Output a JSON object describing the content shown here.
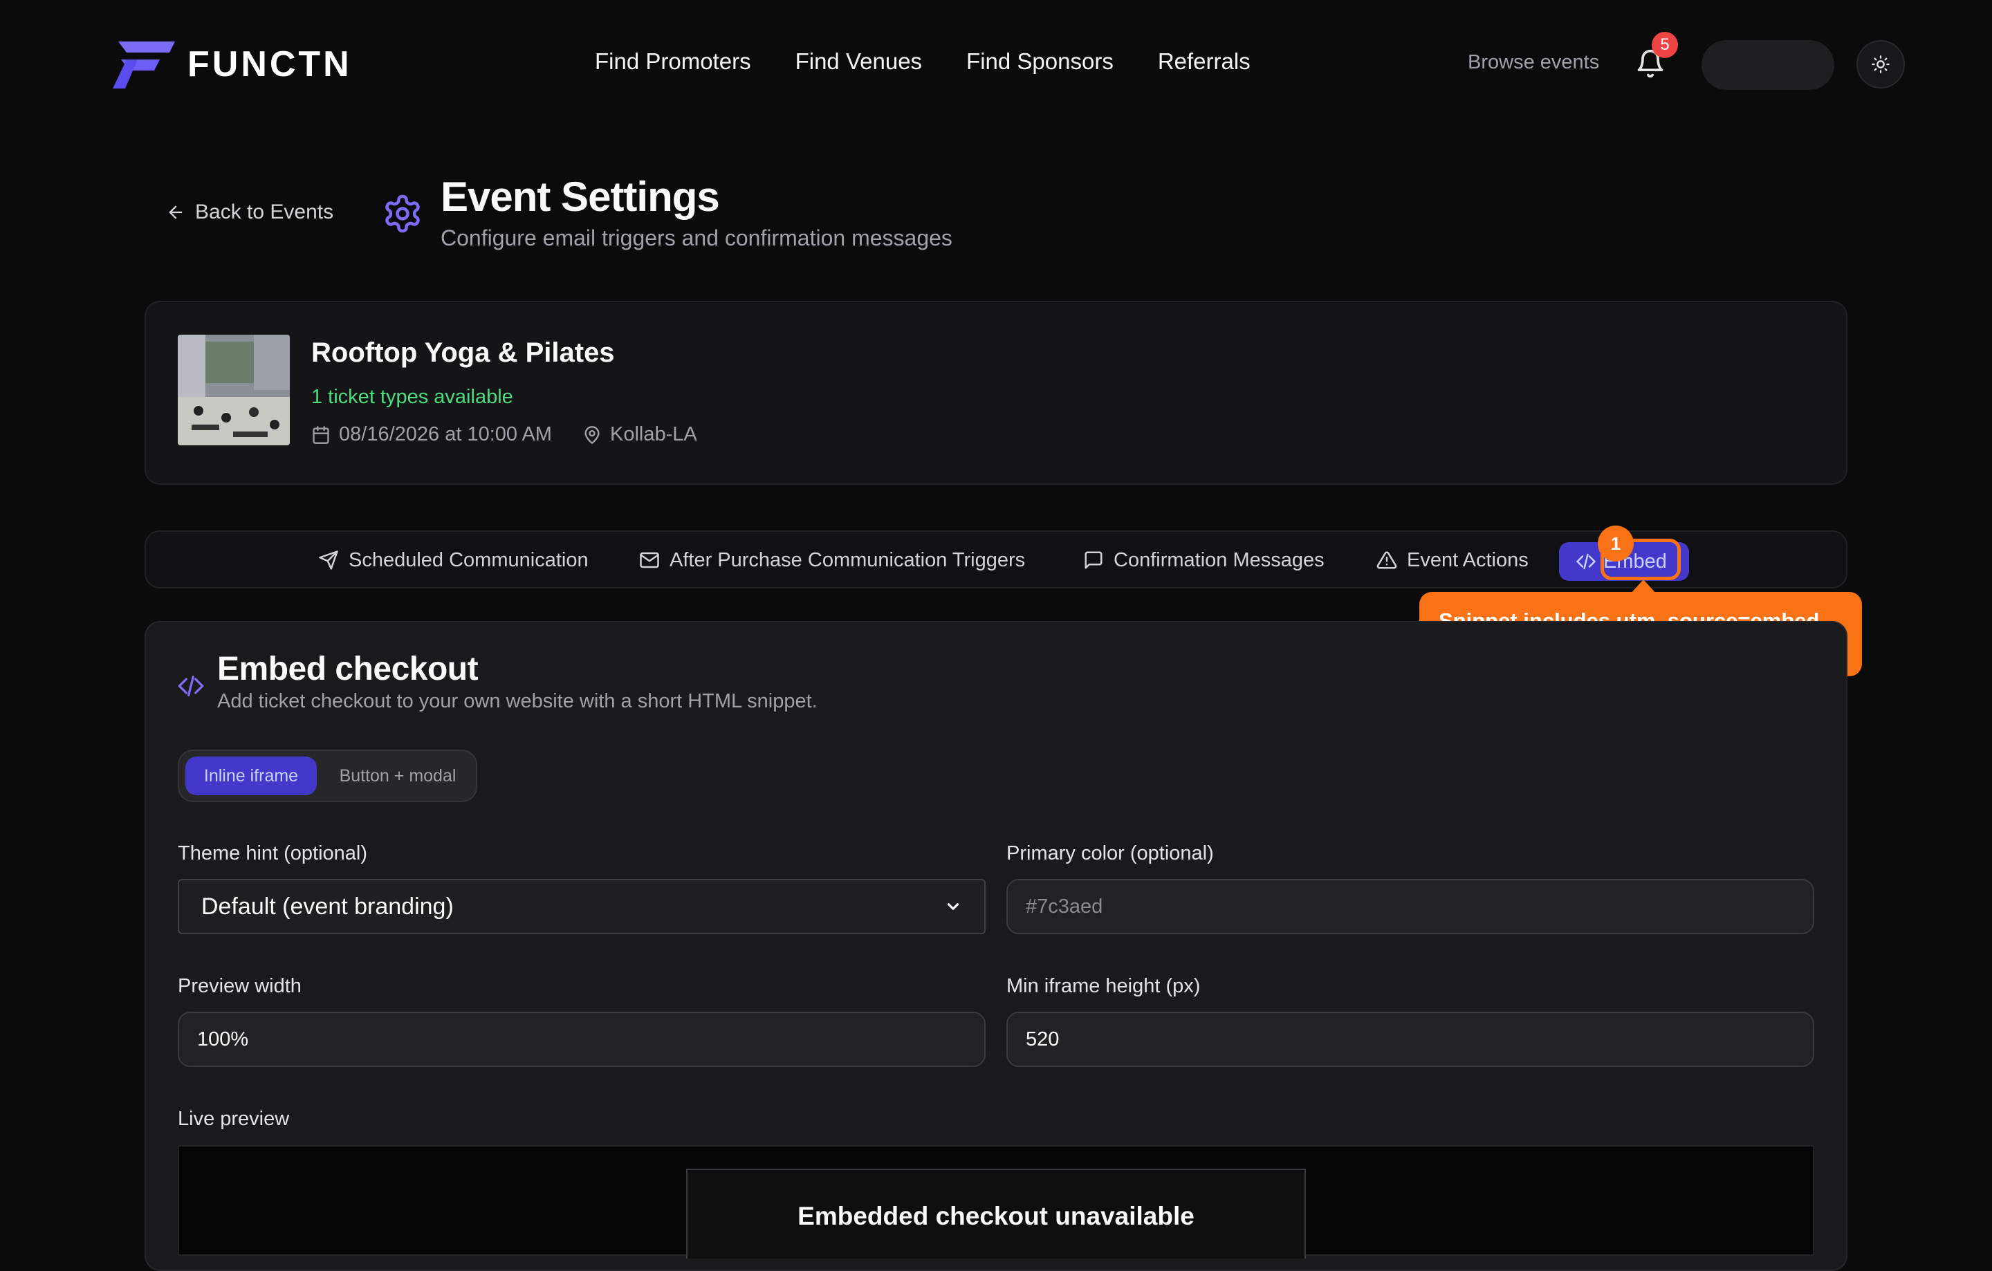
{
  "header": {
    "brand": "FUNCTN",
    "nav": [
      "Find Promoters",
      "Find Venues",
      "Find Sponsors",
      "Referrals"
    ],
    "browse_events": "Browse events",
    "notification_count": "5",
    "accent_color": "#6d5df5"
  },
  "page": {
    "back_label": "Back to Events",
    "title": "Event Settings",
    "subtitle": "Configure email triggers and confirmation messages"
  },
  "event": {
    "name": "Rooftop Yoga & Pilates",
    "tickets": "1 ticket types available",
    "datetime": "08/16/2026 at 10:00 AM",
    "location": "Kollab-LA"
  },
  "tabs": [
    {
      "label": "Scheduled Communication",
      "icon": "send-icon"
    },
    {
      "label": "After Purchase Communication Triggers",
      "icon": "mail-icon"
    },
    {
      "label": "Confirmation Messages",
      "icon": "message-icon"
    },
    {
      "label": "Event Actions",
      "icon": "warning-icon"
    },
    {
      "label": "Embed",
      "icon": "code-icon",
      "active": true
    }
  ],
  "annotation": {
    "step": "1",
    "tooltip": "Snippet includes utm_source=embed when unlocked"
  },
  "embed": {
    "title": "Embed checkout",
    "subtitle": "Add ticket checkout to your own website with a short HTML snippet.",
    "modes": [
      "Inline iframe",
      "Button + modal"
    ],
    "theme_label": "Theme hint (optional)",
    "theme_value": "Default (event branding)",
    "color_label": "Primary color (optional)",
    "color_placeholder": "#7c3aed",
    "width_label": "Preview width",
    "width_value": "100%",
    "height_label": "Min iframe height (px)",
    "height_value": "520",
    "preview_label": "Live preview",
    "preview_title": "Embedded checkout unavailable"
  }
}
